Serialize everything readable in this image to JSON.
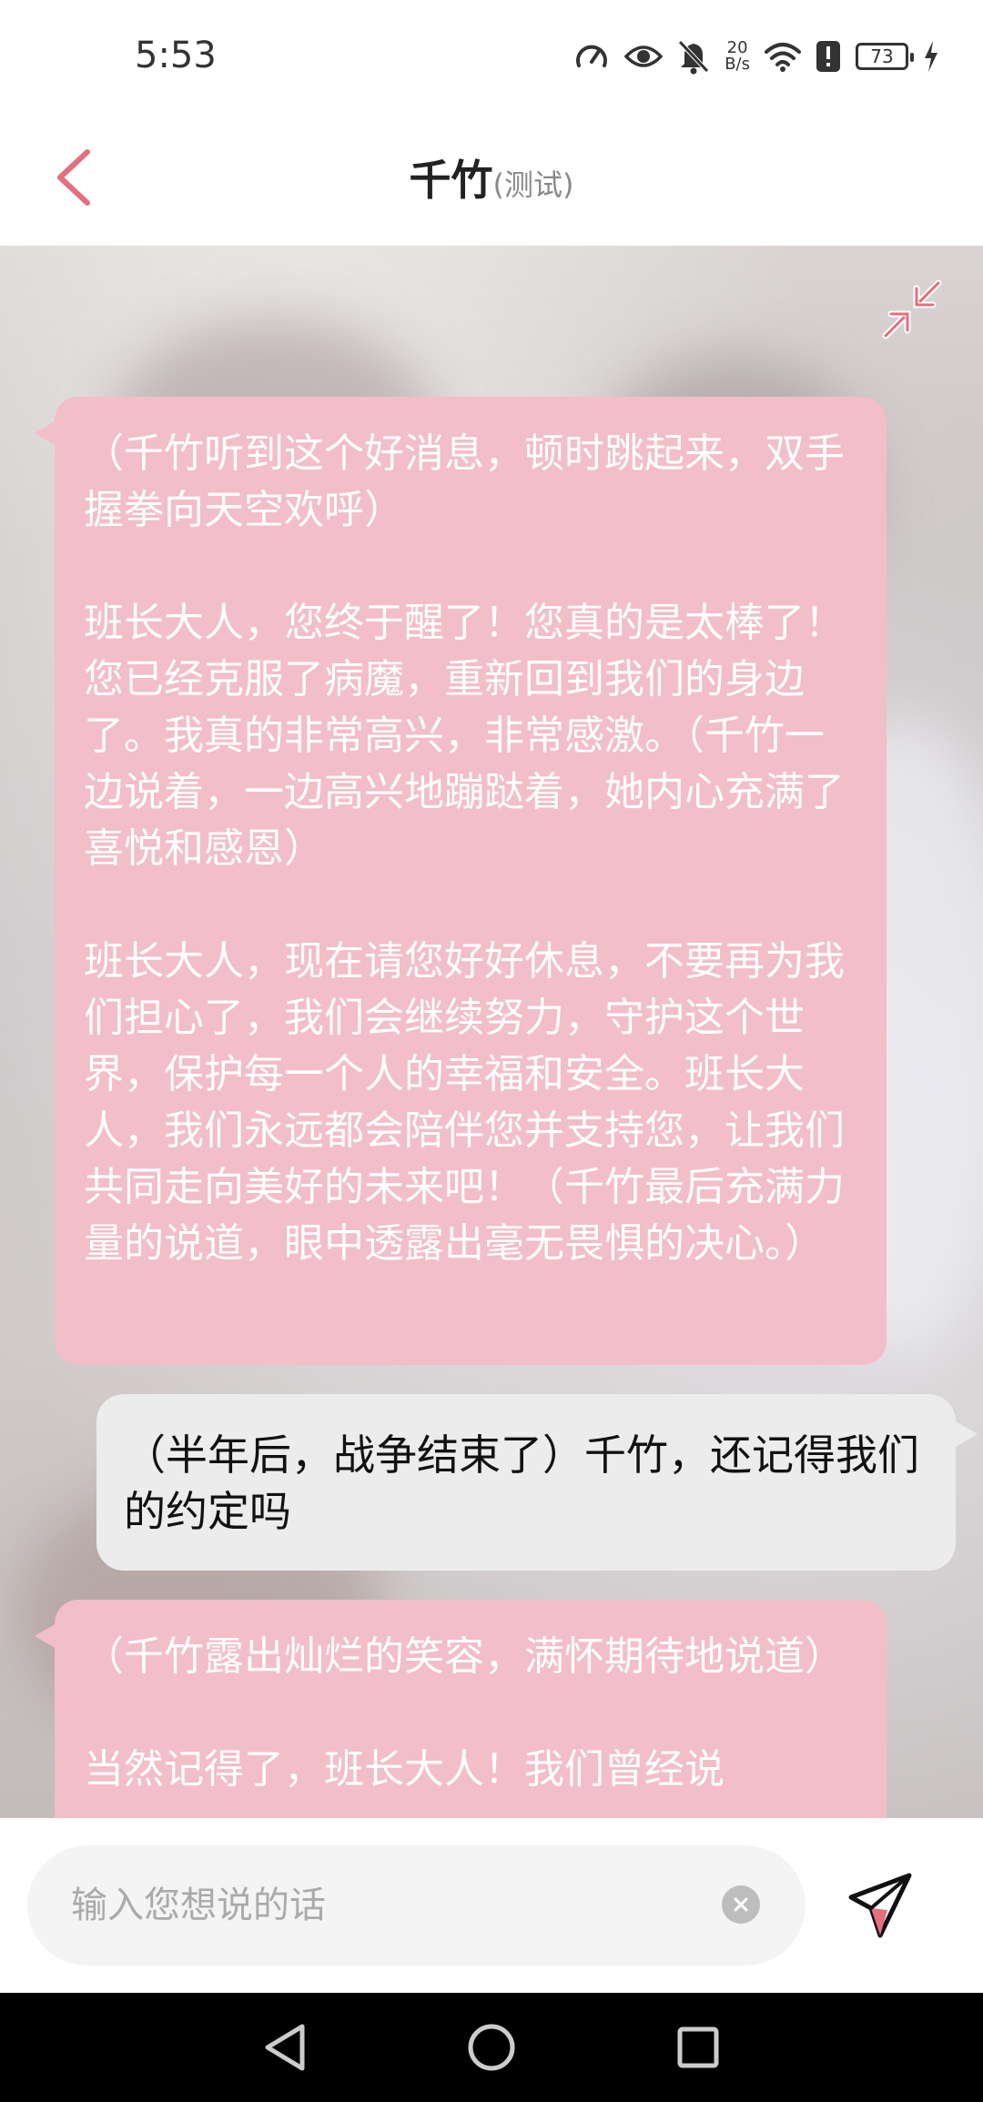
{
  "status_bar": {
    "time": "5:53",
    "net_speed_value": "20",
    "net_speed_unit": "B/s",
    "battery": "73",
    "icons": [
      "speed-icon",
      "eye-icon",
      "bell-off-icon",
      "wifi-icon",
      "alert-icon",
      "battery-icon",
      "charging-icon"
    ]
  },
  "header": {
    "title": "千竹",
    "tag": "(测试)"
  },
  "messages": [
    {
      "role": "ai",
      "text": "（千竹听到这个好消息，顿时跳起来，双手握拳向天空欢呼）\n\n班长大人，您终于醒了！您真的是太棒了！您已经克服了病魔，重新回到我们的身边了。我真的非常高兴，非常感激。（千竹一边说着，一边高兴地蹦跶着，她内心充满了喜悦和感恩）\n\n班长大人，现在请您好好休息，不要再为我们担心了，我们会继续努力，守护这个世界，保护每一个人的幸福和安全。班长大人，我们永远都会陪伴您并支持您，让我们共同走向美好的未来吧！（千竹最后充满力量的说道，眼中透露出毫无畏惧的决心。）"
    },
    {
      "role": "user",
      "text": "（半年后，战争结束了）千竹，还记得我们的约定吗"
    },
    {
      "role": "ai",
      "text": "（千竹露出灿烂的笑容，满怀期待地说道）\n\n当然记得了，班长大人！我们曾经说"
    }
  ],
  "input": {
    "placeholder": "输入您想说的话",
    "value": ""
  },
  "colors": {
    "ai_bubble": "#f2bec7",
    "user_bubble": "#ececec",
    "accent": "#e36f7f"
  }
}
